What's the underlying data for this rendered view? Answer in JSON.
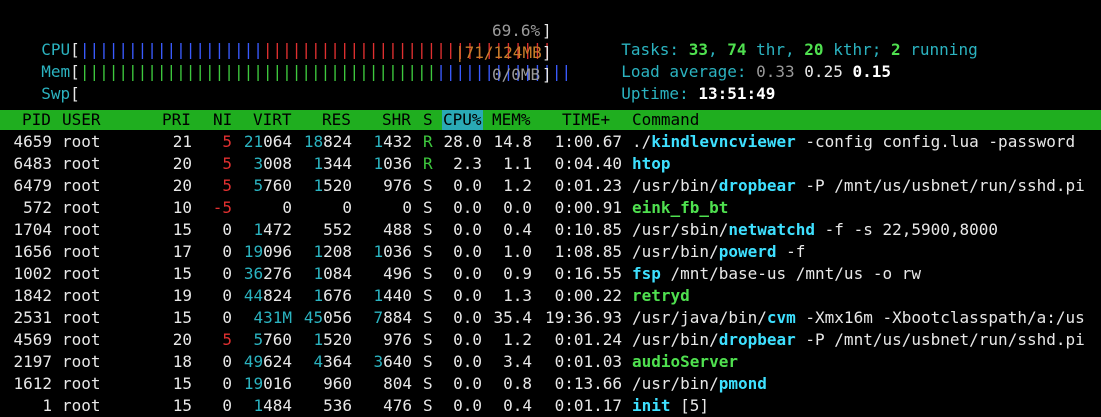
{
  "meters": {
    "cpu": {
      "label": "CPU",
      "value": "69.6%",
      "blue_bars": 19,
      "red_bars": 30
    },
    "mem": {
      "label": "Mem",
      "value": "71/124MB",
      "green_bars": 37,
      "blue_bars": 14
    },
    "swp": {
      "label": "Swp",
      "value": "0/0MB"
    }
  },
  "summary": {
    "tasks_label": "Tasks: ",
    "tasks": "33",
    "thr": "74",
    "thr_label": " thr, ",
    "kthr": "20",
    "kthr_label": " kthr; ",
    "running": "2",
    "running_label": " running",
    "load_label": "Load average: ",
    "load1": "0.33",
    "load5": "0.25",
    "load15": "0.15",
    "uptime_label": "Uptime: ",
    "uptime": "13:51:49"
  },
  "header": {
    "columns": [
      "PID",
      "USER",
      "PRI",
      "NI",
      "VIRT",
      "RES",
      "SHR",
      "S",
      "CPU%",
      "MEM%",
      "TIME+",
      "Command"
    ],
    "sorted": "CPU%"
  },
  "processes": [
    {
      "pid": "4659",
      "user": "root",
      "pri": "21",
      "ni": "5",
      "virt_hi": "21",
      "virt_lo": "064",
      "res_hi": "18",
      "res_lo": "824",
      "shr_hi": "1",
      "shr_lo": "432",
      "s": "R",
      "cpu": "28.0",
      "mem": "14.8",
      "time": "1:00.67",
      "path": "./",
      "bin": "kindlevncviewer",
      "args": " -config config.lua -password"
    },
    {
      "pid": "6483",
      "user": "root",
      "pri": "20",
      "ni": "5",
      "virt_hi": "3",
      "virt_lo": "008",
      "res_hi": "1",
      "res_lo": "344",
      "shr_hi": "1",
      "shr_lo": "036",
      "s": "R",
      "cpu": "2.3",
      "mem": "1.1",
      "time": "0:04.40",
      "path": "",
      "bin": "htop",
      "args": ""
    },
    {
      "pid": "6479",
      "user": "root",
      "pri": "20",
      "ni": "5",
      "virt_hi": "5",
      "virt_lo": "760",
      "res_hi": "1",
      "res_lo": "520",
      "shr_hi": "",
      "shr_lo": "976",
      "s": "S",
      "cpu": "0.0",
      "mem": "1.2",
      "time": "0:01.23",
      "path": "/usr/bin/",
      "bin": "dropbear",
      "args": " -P /mnt/us/usbnet/run/sshd.pi"
    },
    {
      "pid": "572",
      "user": "root",
      "pri": "10",
      "ni": "-5",
      "virt_hi": "",
      "virt_lo": "0",
      "res_hi": "",
      "res_lo": "0",
      "shr_hi": "",
      "shr_lo": "0",
      "s": "S",
      "cpu": "0.0",
      "mem": "0.0",
      "time": "0:00.91",
      "path": "",
      "bin": "eink_fb_bt",
      "args": "",
      "green": true
    },
    {
      "pid": "1704",
      "user": "root",
      "pri": "15",
      "ni": "0",
      "virt_hi": "1",
      "virt_lo": "472",
      "res_hi": "",
      "res_lo": "552",
      "shr_hi": "",
      "shr_lo": "488",
      "s": "S",
      "cpu": "0.0",
      "mem": "0.4",
      "time": "0:10.85",
      "path": "/usr/sbin/",
      "bin": "netwatchd",
      "args": " -f -s 22,5900,8000"
    },
    {
      "pid": "1656",
      "user": "root",
      "pri": "17",
      "ni": "0",
      "virt_hi": "19",
      "virt_lo": "096",
      "res_hi": "1",
      "res_lo": "208",
      "shr_hi": "1",
      "shr_lo": "036",
      "s": "S",
      "cpu": "0.0",
      "mem": "1.0",
      "time": "1:08.85",
      "path": "/usr/bin/",
      "bin": "powerd",
      "args": " -f"
    },
    {
      "pid": "1002",
      "user": "root",
      "pri": "15",
      "ni": "0",
      "virt_hi": "36",
      "virt_lo": "276",
      "res_hi": "1",
      "res_lo": "084",
      "shr_hi": "",
      "shr_lo": "496",
      "s": "S",
      "cpu": "0.0",
      "mem": "0.9",
      "time": "0:16.55",
      "path": "",
      "bin": "fsp",
      "args": " /mnt/base-us /mnt/us -o rw"
    },
    {
      "pid": "1842",
      "user": "root",
      "pri": "19",
      "ni": "0",
      "virt_hi": "44",
      "virt_lo": "824",
      "res_hi": "1",
      "res_lo": "676",
      "shr_hi": "1",
      "shr_lo": "440",
      "s": "S",
      "cpu": "0.0",
      "mem": "1.3",
      "time": "0:00.22",
      "path": "",
      "bin": "retryd",
      "args": "",
      "green": true
    },
    {
      "pid": "2531",
      "user": "root",
      "pri": "15",
      "ni": "0",
      "virt_hi": "431M",
      "virt_lo": "",
      "res_hi": "45",
      "res_lo": "056",
      "shr_hi": "7",
      "shr_lo": "884",
      "s": "S",
      "cpu": "0.0",
      "mem": "35.4",
      "time": "19:36.93",
      "path": "/usr/java/bin/",
      "bin": "cvm",
      "args": " -Xmx16m -Xbootclasspath/a:/us"
    },
    {
      "pid": "4569",
      "user": "root",
      "pri": "20",
      "ni": "5",
      "virt_hi": "5",
      "virt_lo": "760",
      "res_hi": "1",
      "res_lo": "520",
      "shr_hi": "",
      "shr_lo": "976",
      "s": "S",
      "cpu": "0.0",
      "mem": "1.2",
      "time": "0:01.24",
      "path": "/usr/bin/",
      "bin": "dropbear",
      "args": " -P /mnt/us/usbnet/run/sshd.pi"
    },
    {
      "pid": "2197",
      "user": "root",
      "pri": "18",
      "ni": "0",
      "virt_hi": "49",
      "virt_lo": "624",
      "res_hi": "4",
      "res_lo": "364",
      "shr_hi": "3",
      "shr_lo": "640",
      "s": "S",
      "cpu": "0.0",
      "mem": "3.4",
      "time": "0:01.03",
      "path": "",
      "bin": "audioServer",
      "args": "",
      "green": true
    },
    {
      "pid": "1612",
      "user": "root",
      "pri": "15",
      "ni": "0",
      "virt_hi": "19",
      "virt_lo": "016",
      "res_hi": "",
      "res_lo": "960",
      "shr_hi": "",
      "shr_lo": "804",
      "s": "S",
      "cpu": "0.0",
      "mem": "0.8",
      "time": "0:13.66",
      "path": "/usr/bin/",
      "bin": "pmond",
      "args": ""
    },
    {
      "pid": "1",
      "user": "root",
      "pri": "15",
      "ni": "0",
      "virt_hi": "1",
      "virt_lo": "484",
      "res_hi": "",
      "res_lo": "536",
      "shr_hi": "",
      "shr_lo": "476",
      "s": "S",
      "cpu": "0.0",
      "mem": "0.4",
      "time": "0:01.17",
      "path": "",
      "bin": "init",
      "args": " [5]"
    }
  ]
}
